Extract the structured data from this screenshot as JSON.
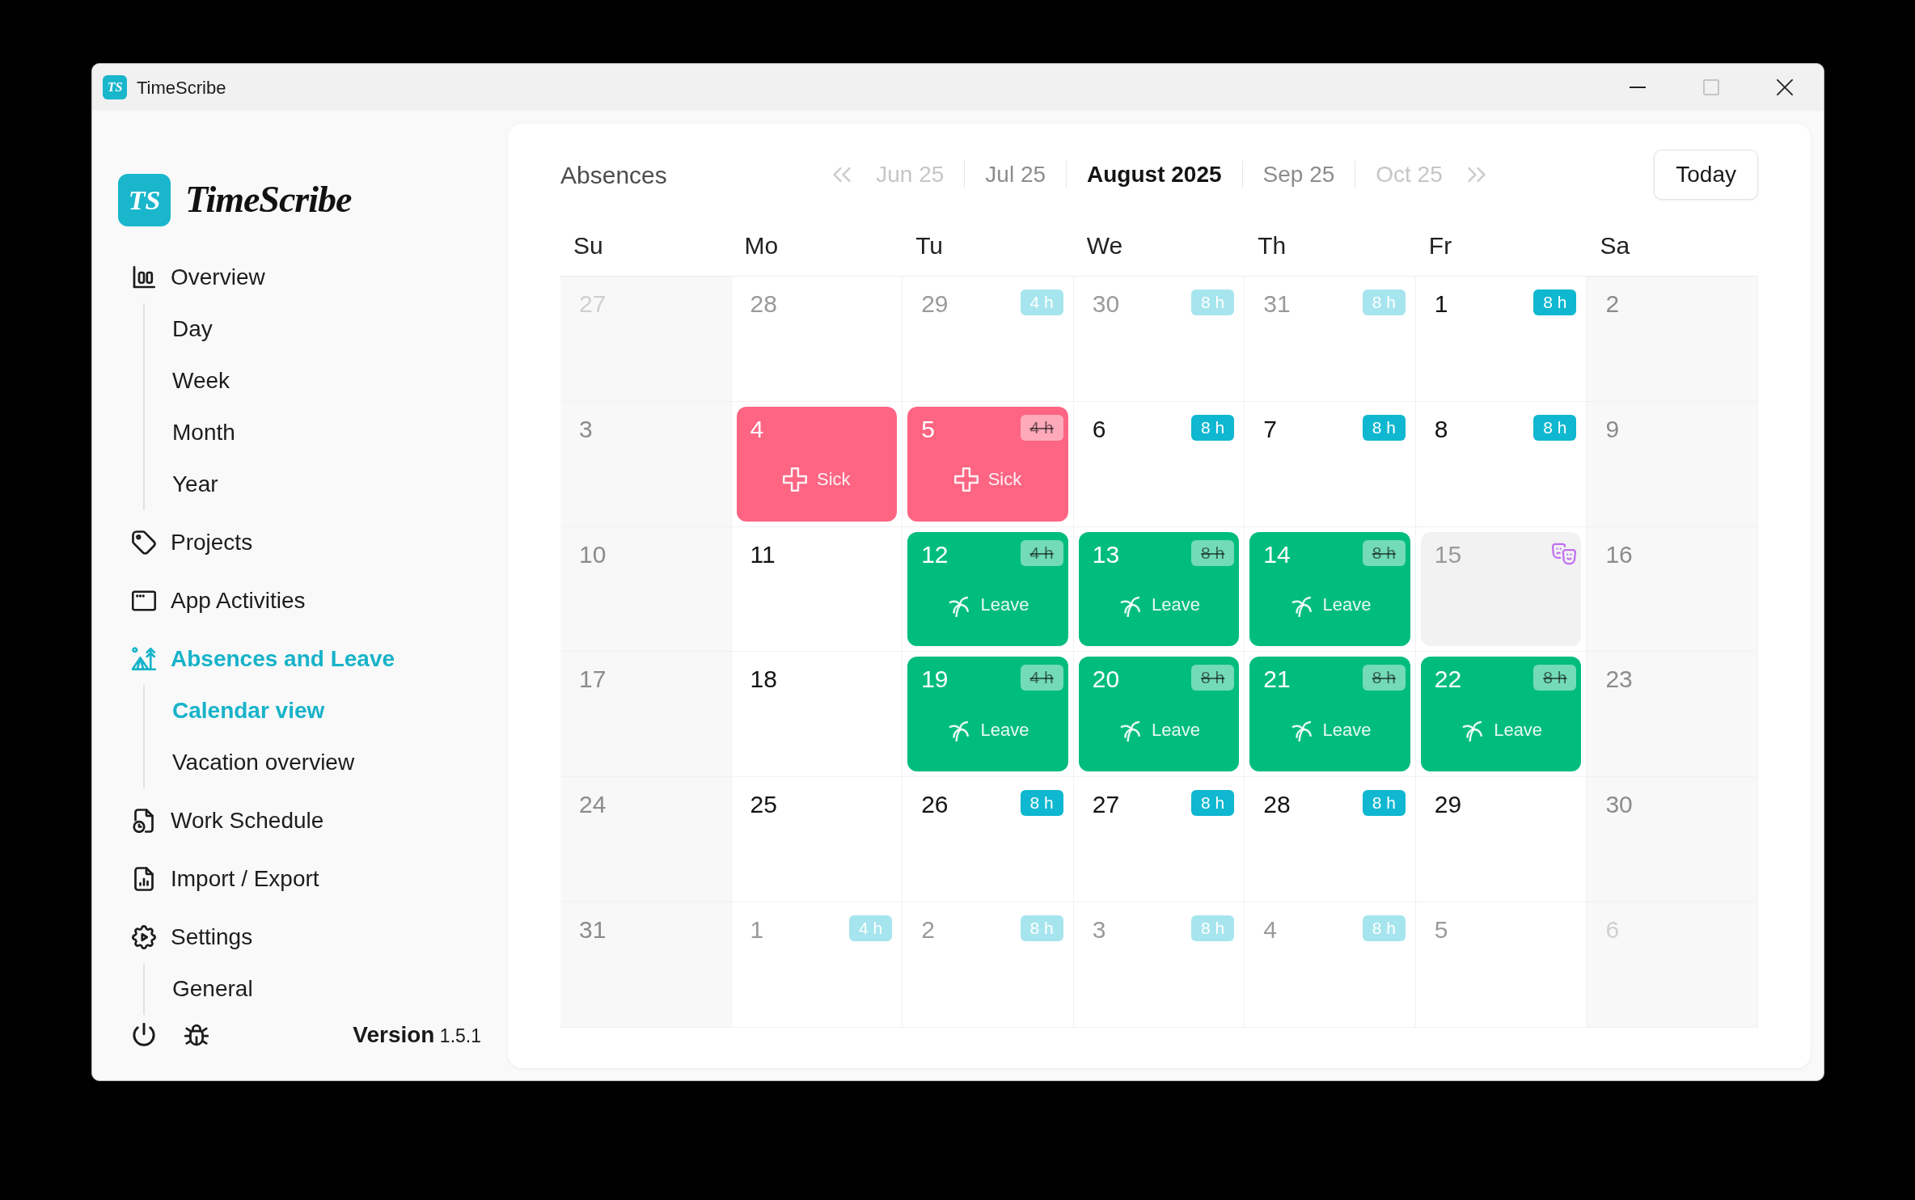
{
  "window": {
    "icon_text": "TS",
    "title": "TimeScribe",
    "maximize_disabled": true
  },
  "sidebar": {
    "logo_mark": "TS",
    "logo_text": "TimeScribe",
    "items": [
      {
        "label": "Overview",
        "selected": false,
        "children": [
          {
            "label": "Day",
            "selected": false
          },
          {
            "label": "Week",
            "selected": false
          },
          {
            "label": "Month",
            "selected": false
          },
          {
            "label": "Year",
            "selected": false
          }
        ]
      },
      {
        "label": "Projects",
        "selected": false
      },
      {
        "label": "App Activities",
        "selected": false
      },
      {
        "label": "Absences and Leave",
        "selected": true,
        "children": [
          {
            "label": "Calendar view",
            "selected": true
          },
          {
            "label": "Vacation overview",
            "selected": false
          }
        ]
      },
      {
        "label": "Work Schedule",
        "selected": false
      },
      {
        "label": "Import / Export",
        "selected": false
      },
      {
        "label": "Settings",
        "selected": false,
        "children": [
          {
            "label": "General",
            "selected": false
          }
        ]
      }
    ],
    "version": "**Version** 1.5.1"
  },
  "absences": {
    "title": "Absences",
    "months": [
      {
        "label": "Jun 25",
        "selected": false
      },
      {
        "label": "Jul 25",
        "selected": false
      },
      {
        "label": "August 2025",
        "selected": true
      },
      {
        "label": "Sep 25",
        "selected": false
      },
      {
        "label": "Oct 25",
        "selected": false
      }
    ],
    "today_button": "Today",
    "weekdays": [
      "Su",
      "Mo",
      "Tu",
      "We",
      "Th",
      "Fr",
      "Sa"
    ],
    "weeks": [
      {
        "days": [
          {
            "number": "27",
            "outside": true
          },
          {
            "number": "28",
            "outside": true
          },
          {
            "number": "29",
            "outside": true,
            "hours": "4 h",
            "hours_struck": false
          },
          {
            "number": "30",
            "outside": true,
            "hours": "8 h",
            "hours_struck": false
          },
          {
            "number": "31",
            "outside": true,
            "hours": "8 h",
            "hours_struck": false
          },
          {
            "number": "1",
            "outside": false,
            "hours": "8 h",
            "hours_struck": false
          },
          {
            "number": "2",
            "outside": false
          }
        ]
      },
      {
        "days": [
          {
            "number": "3",
            "outside": false
          },
          {
            "number": "4",
            "outside": false,
            "absence": {
              "kind": "sick",
              "label": "Sick"
            }
          },
          {
            "number": "5",
            "outside": false,
            "hours": "4 h",
            "hours_struck": true,
            "absence": {
              "kind": "sick",
              "label": "Sick"
            }
          },
          {
            "number": "6",
            "outside": false,
            "hours": "8 h",
            "hours_struck": false
          },
          {
            "number": "7",
            "outside": false,
            "hours": "8 h",
            "hours_struck": false
          },
          {
            "number": "8",
            "outside": false,
            "hours": "8 h",
            "hours_struck": false
          },
          {
            "number": "9",
            "outside": false
          }
        ]
      },
      {
        "days": [
          {
            "number": "10",
            "outside": false
          },
          {
            "number": "11",
            "outside": false
          },
          {
            "number": "12",
            "outside": false,
            "hours": "4 h",
            "hours_struck": true,
            "absence": {
              "kind": "leave",
              "label": "Leave"
            }
          },
          {
            "number": "13",
            "outside": false,
            "hours": "8 h",
            "hours_struck": true,
            "absence": {
              "kind": "leave",
              "label": "Leave"
            }
          },
          {
            "number": "14",
            "outside": false,
            "hours": "8 h",
            "hours_struck": true,
            "absence": {
              "kind": "leave",
              "label": "Leave"
            }
          },
          {
            "number": "15",
            "outside": false,
            "absence": {
              "kind": "holiday"
            }
          },
          {
            "number": "16",
            "outside": false
          }
        ]
      },
      {
        "days": [
          {
            "number": "17",
            "outside": false
          },
          {
            "number": "18",
            "outside": false
          },
          {
            "number": "19",
            "outside": false,
            "hours": "4 h",
            "hours_struck": true,
            "absence": {
              "kind": "leave",
              "label": "Leave"
            }
          },
          {
            "number": "20",
            "outside": false,
            "hours": "8 h",
            "hours_struck": true,
            "absence": {
              "kind": "leave",
              "label": "Leave"
            }
          },
          {
            "number": "21",
            "outside": false,
            "hours": "8 h",
            "hours_struck": true,
            "absence": {
              "kind": "leave",
              "label": "Leave"
            }
          },
          {
            "number": "22",
            "outside": false,
            "hours": "8 h",
            "hours_struck": true,
            "absence": {
              "kind": "leave",
              "label": "Leave"
            }
          },
          {
            "number": "23",
            "outside": false
          }
        ]
      },
      {
        "days": [
          {
            "number": "24",
            "outside": false
          },
          {
            "number": "25",
            "outside": false
          },
          {
            "number": "26",
            "outside": false,
            "hours": "8 h",
            "hours_struck": false
          },
          {
            "number": "27",
            "outside": false,
            "hours": "8 h",
            "hours_struck": false
          },
          {
            "number": "28",
            "outside": false,
            "hours": "8 h",
            "hours_struck": false
          },
          {
            "number": "29",
            "outside": false
          },
          {
            "number": "30",
            "outside": false
          }
        ]
      },
      {
        "days": [
          {
            "number": "31",
            "outside": false
          },
          {
            "number": "1",
            "outside": true,
            "hours": "4 h",
            "hours_struck": false
          },
          {
            "number": "2",
            "outside": true,
            "hours": "8 h",
            "hours_struck": false
          },
          {
            "number": "3",
            "outside": true,
            "hours": "8 h",
            "hours_struck": false
          },
          {
            "number": "4",
            "outside": true,
            "hours": "8 h",
            "hours_struck": false
          },
          {
            "number": "5",
            "outside": true
          },
          {
            "number": "6",
            "outside": true
          }
        ]
      }
    ]
  }
}
